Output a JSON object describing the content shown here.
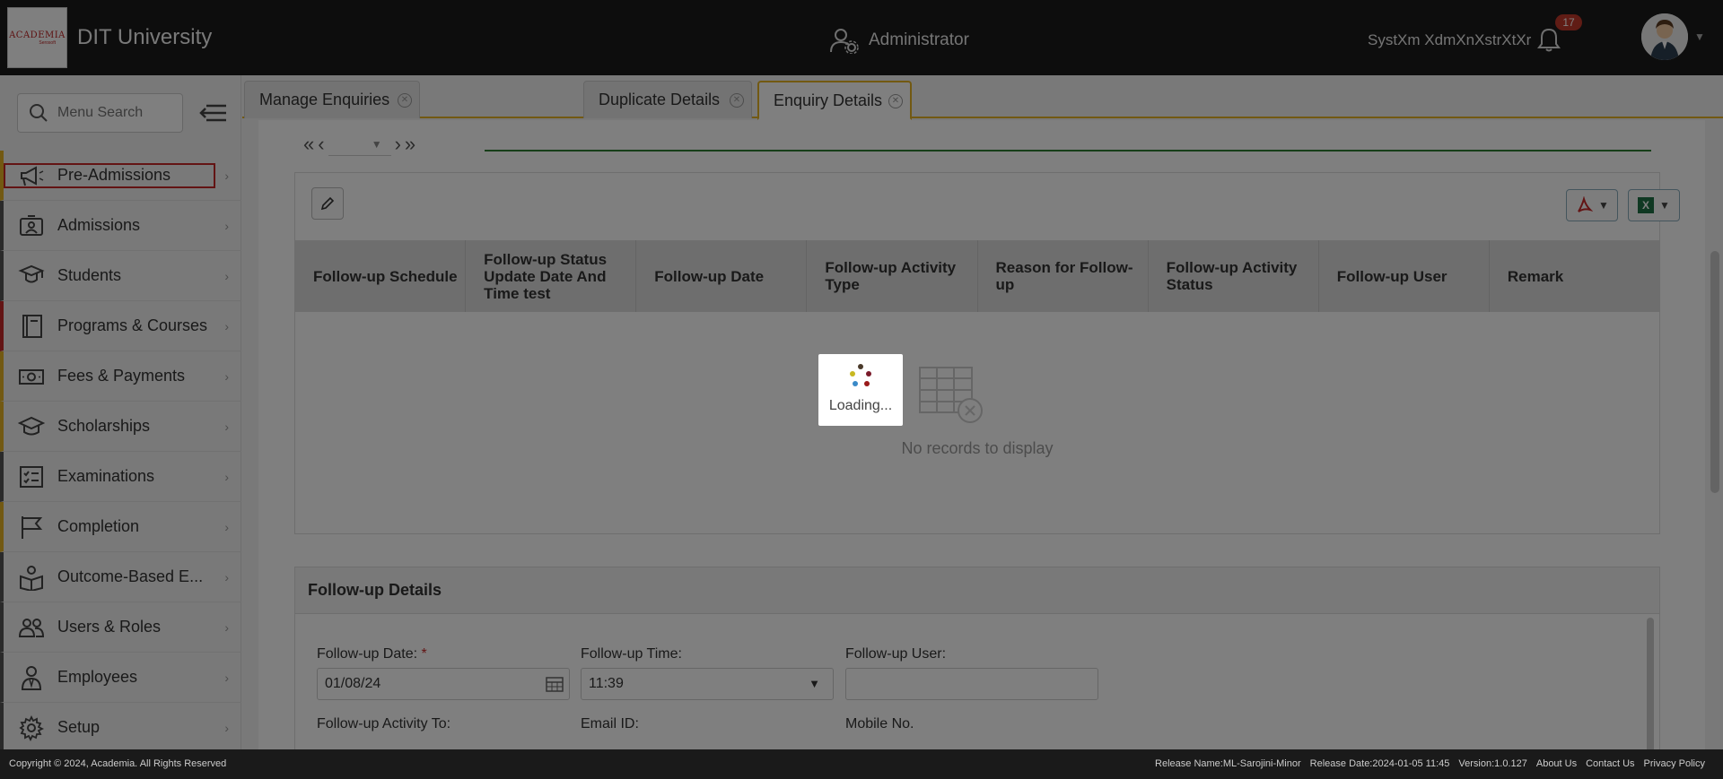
{
  "header": {
    "logo_text": "ACADEMIA",
    "logo_sub": "Serosoft",
    "university": "DIT University",
    "role": "Administrator",
    "user": "SystXm XdmXnXstrXtXr",
    "notifications": "17"
  },
  "sidebar": {
    "search_placeholder": "Menu Search",
    "items": [
      {
        "label": "Pre-Admissions",
        "icon": "megaphone-icon",
        "color": "#e5b325"
      },
      {
        "label": "Admissions",
        "icon": "id-card-icon",
        "color": "#555555"
      },
      {
        "label": "Students",
        "icon": "student-icon",
        "color": "#555555"
      },
      {
        "label": "Programs & Courses",
        "icon": "book-icon",
        "color": "#c62828"
      },
      {
        "label": "Fees & Payments",
        "icon": "money-icon",
        "color": "#e5b325"
      },
      {
        "label": "Scholarships",
        "icon": "graduation-cap-icon",
        "color": "#e5b325"
      },
      {
        "label": "Examinations",
        "icon": "checklist-icon",
        "color": "#555555"
      },
      {
        "label": "Completion",
        "icon": "flag-icon",
        "color": "#e5b325"
      },
      {
        "label": "Outcome-Based E...",
        "icon": "book-person-icon",
        "color": "#555555"
      },
      {
        "label": "Users & Roles",
        "icon": "users-icon",
        "color": "#555555"
      },
      {
        "label": "Employees",
        "icon": "employee-icon",
        "color": "#555555"
      },
      {
        "label": "Setup",
        "icon": "gear-icon",
        "color": "#555555"
      }
    ]
  },
  "tabs": [
    {
      "label": "Manage Enquiries"
    },
    {
      "label": "Duplicate Details"
    },
    {
      "label": "Enquiry Details"
    }
  ],
  "grid": {
    "columns": [
      "Follow-up Schedule",
      "Follow-up Status Update Date And Time test",
      "Follow-up Date",
      "Follow-up Activity Type",
      "Reason for Follow-up",
      "Follow-up Activity Status",
      "Follow-up User",
      "Remark"
    ],
    "empty_text": "No records to display"
  },
  "details": {
    "title": "Follow-up Details",
    "date_label": "Follow-up Date:",
    "date_required": "*",
    "date_value": "01/08/24",
    "time_label": "Follow-up Time:",
    "time_value": "11:39",
    "user_label": "Follow-up User:",
    "user_value": "",
    "activity_to_label": "Follow-up Activity To:",
    "email_label": "Email ID:",
    "mobile_label": "Mobile No."
  },
  "loader": {
    "text": "Loading..."
  },
  "footer": {
    "copyright": "Copyright © 2024, Academia. All Rights Reserved",
    "release_name": "Release Name:ML-Sarojini-Minor",
    "release_date": "Release Date:2024-01-05 11:45",
    "version": "Version:1.0.127",
    "about": "About Us",
    "contact": "Contact Us",
    "privacy": "Privacy Policy"
  }
}
